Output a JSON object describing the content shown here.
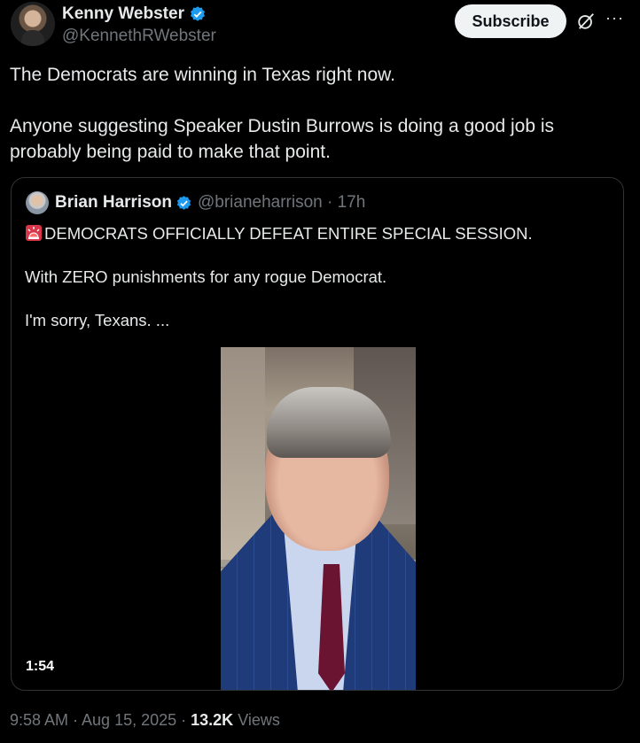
{
  "author": {
    "name": "Kenny Webster",
    "handle": "@KennethRWebster",
    "verified_icon": "verified-badge-icon"
  },
  "actions": {
    "subscribe_label": "Subscribe",
    "grok_icon": "grok-icon",
    "more_label": "···"
  },
  "tweet": {
    "line1": "The Democrats are winning in Texas right now.",
    "line2": "Anyone suggesting Speaker Dustin Burrows is doing a good job is probably being paid to make that point."
  },
  "quote": {
    "name": "Brian Harrison",
    "handle_time": "@brianeharrison · 17h",
    "headline": "DEMOCRATS OFFICIALLY DEFEAT ENTIRE SPECIAL SESSION.",
    "line2": "With ZERO punishments for any rogue Democrat.",
    "line3": "I'm sorry, Texans. ...",
    "video_duration": "1:54"
  },
  "footer": {
    "time_date": "9:58 AM · Aug 15, 2025 · ",
    "views_count": "13.2K",
    "views_label": " Views"
  },
  "colors": {
    "background": "#000000",
    "text": "#e7e9ea",
    "muted": "#71767b",
    "verified": "#1d9bf0",
    "border": "#2f3336"
  }
}
